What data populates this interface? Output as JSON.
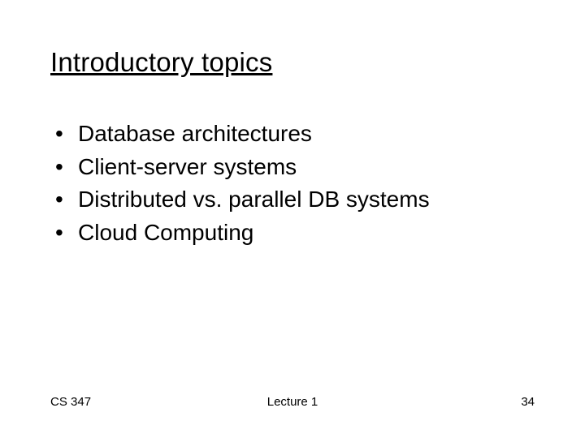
{
  "title": "Introductory topics",
  "bullets": [
    "Database architectures",
    "Client-server systems",
    "Distributed vs. parallel DB systems",
    "Cloud Computing"
  ],
  "footer": {
    "left": "CS 347",
    "center": "Lecture 1",
    "right": "34"
  }
}
